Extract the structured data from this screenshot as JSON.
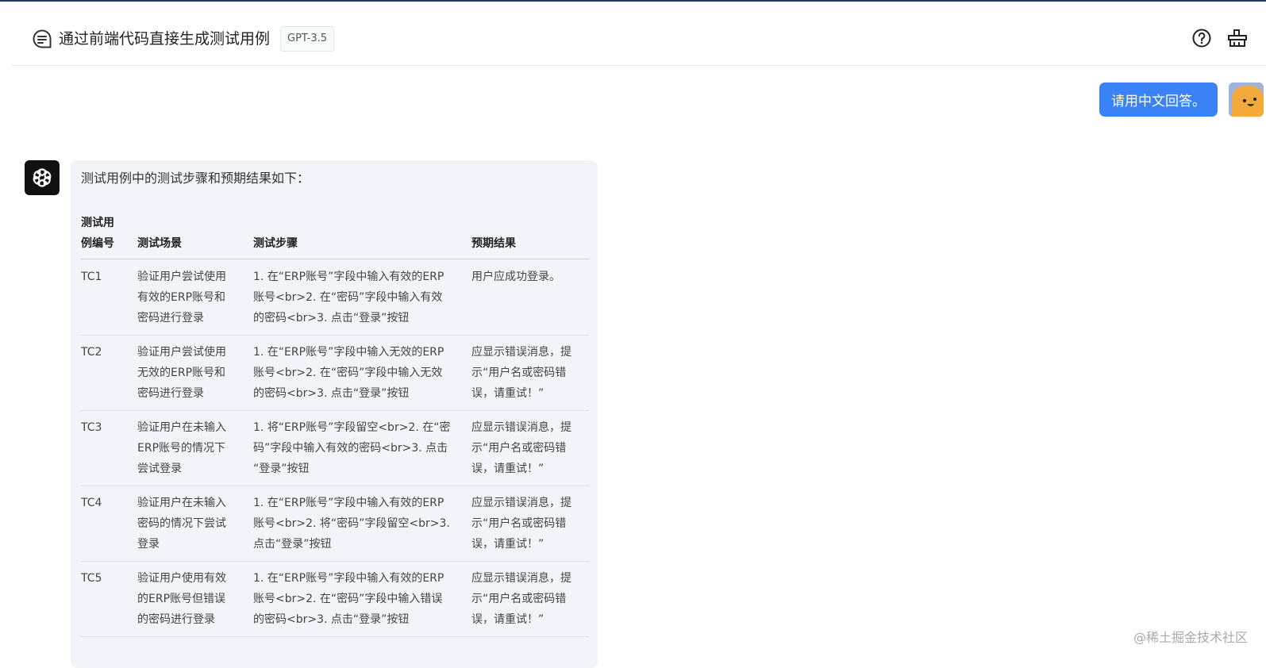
{
  "header": {
    "title": "通过前端代码直接生成测试用例",
    "model": "GPT-3.5",
    "help_icon": "help-circle-icon",
    "clear_icon": "broom-icon"
  },
  "user_message": {
    "text": "请用中文回答。"
  },
  "bot_message": {
    "intro": "测试用例中的测试步骤和预期结果如下：",
    "table": {
      "headers": [
        "测试用例编号",
        "测试场景",
        "测试步骤",
        "预期结果"
      ],
      "rows": [
        {
          "id": "TC1",
          "scenario": "验证用户尝试使用有效的ERP账号和密码进行登录",
          "steps": "1. 在“ERP账号”字段中输入有效的ERP账号<br>2. 在“密码”字段中输入有效的密码<br>3. 点击“登录”按钮",
          "expected": "用户应成功登录。"
        },
        {
          "id": "TC2",
          "scenario": "验证用户尝试使用无效的ERP账号和密码进行登录",
          "steps": "1. 在“ERP账号”字段中输入无效的ERP账号<br>2. 在“密码”字段中输入无效的密码<br>3. 点击“登录”按钮",
          "expected": "应显示错误消息，提示“用户名或密码错误，请重试！”"
        },
        {
          "id": "TC3",
          "scenario": "验证用户在未输入ERP账号的情况下尝试登录",
          "steps": "1. 将“ERP账号”字段留空<br>2. 在“密码”字段中输入有效的密码<br>3. 点击“登录”按钮",
          "expected": "应显示错误消息，提示“用户名或密码错误，请重试！”"
        },
        {
          "id": "TC4",
          "scenario": "验证用户在未输入密码的情况下尝试登录",
          "steps": "1. 在“ERP账号”字段中输入有效的ERP账号<br>2. 将“密码”字段留空<br>3. 点击“登录”按钮",
          "expected": "应显示错误消息，提示“用户名或密码错误，请重试！”"
        },
        {
          "id": "TC5",
          "scenario": "验证用户使用有效的ERP账号但错误的密码进行登录",
          "steps": "1. 在“ERP账号”字段中输入有效的ERP账号<br>2. 在“密码”字段中输入错误的密码<br>3. 点击“登录”按钮",
          "expected": "应显示错误消息，提示“用户名或密码错误，请重试！”"
        }
      ]
    }
  },
  "watermark": "@稀土掘金技术社区",
  "colors": {
    "accent": "#3b82f6",
    "bot_bubble": "#f1f4f8",
    "top_line": "#1f3a5a"
  }
}
